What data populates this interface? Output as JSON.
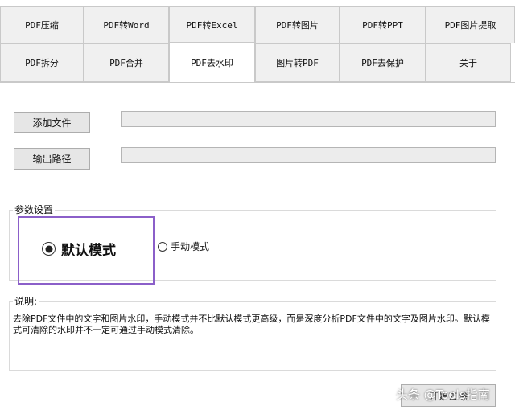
{
  "tabs": {
    "row1": [
      "PDF压缩",
      "PDF转Word",
      "PDF转Excel",
      "PDF转图片",
      "PDF转PPT",
      "PDF图片提取"
    ],
    "row2": [
      "PDF拆分",
      "PDF合并",
      "PDF去水印",
      "图片转PDF",
      "PDF去保护",
      "关于"
    ],
    "active": "PDF去水印"
  },
  "files": {
    "add_label": "添加文件",
    "add_value": "",
    "output_label": "输出路径",
    "output_value": ""
  },
  "params": {
    "title": "参数设置",
    "options": [
      {
        "label": "默认模式",
        "checked": true
      },
      {
        "label": "手动模式",
        "checked": false
      }
    ]
  },
  "description": {
    "title": "说明:",
    "text": "去除PDF文件中的文字和图片水印，手动模式并不比默认模式更高级，而是深度分析PDF文件中的文字及图片水印。默认模式可清除的水印并不一定可通过手动模式清除。"
  },
  "footer": {
    "button_label": "开始去除",
    "watermark": "头条 @Tools指南"
  },
  "colors": {
    "highlight": "#8b5fc9",
    "tab_bg": "#f0f0f0",
    "field_bg": "#ececec"
  }
}
